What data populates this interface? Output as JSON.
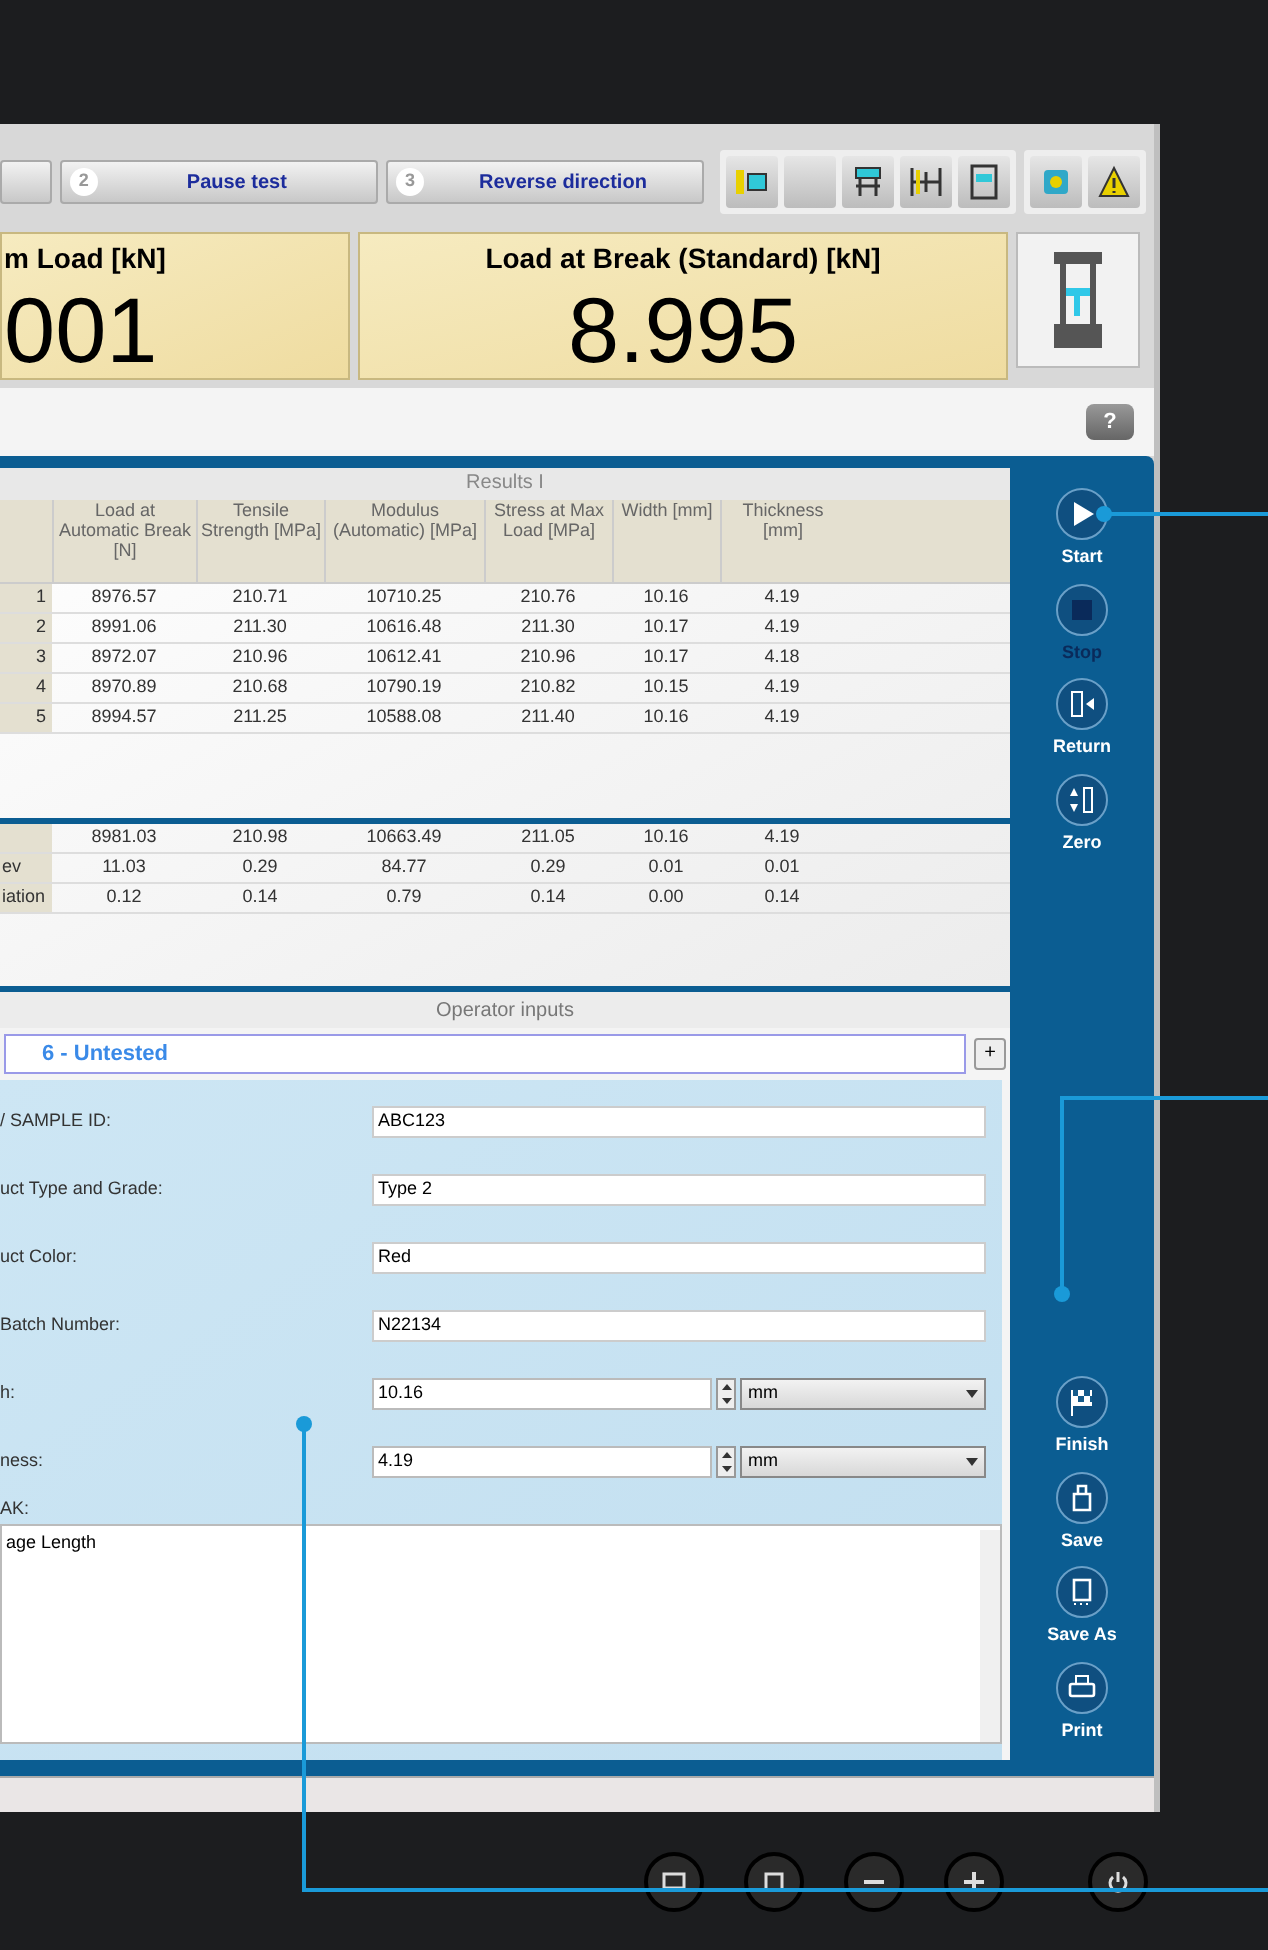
{
  "toolbar": {
    "steps": [
      {
        "selected": false
      },
      {
        "number": "2",
        "label": "Pause test",
        "selected": false
      },
      {
        "number": "3",
        "label": "Reverse direction",
        "selected": false
      }
    ]
  },
  "help_button": "?",
  "readouts": [
    {
      "label": "m Load [kN]",
      "value": "001"
    },
    {
      "label": "Load at Break (Standard) [kN]",
      "value": "8.995"
    }
  ],
  "results": {
    "title": "Results I",
    "columns": [
      "Load at Automatic Break [N]",
      "Tensile Strength [MPa]",
      "Modulus (Automatic) [MPa]",
      "Stress at Max Load [MPa]",
      "Width [mm]",
      "Thickness [mm]"
    ],
    "rows": [
      {
        "label": "1",
        "cells": [
          "8976.57",
          "210.71",
          "10710.25",
          "210.76",
          "10.16",
          "4.19"
        ]
      },
      {
        "label": "2",
        "cells": [
          "8991.06",
          "211.30",
          "10616.48",
          "211.30",
          "10.17",
          "4.19"
        ]
      },
      {
        "label": "3",
        "cells": [
          "8972.07",
          "210.96",
          "10612.41",
          "210.96",
          "10.17",
          "4.18"
        ]
      },
      {
        "label": "4",
        "cells": [
          "8970.89",
          "210.68",
          "10790.19",
          "210.82",
          "10.15",
          "4.19"
        ]
      },
      {
        "label": "5",
        "cells": [
          "8994.57",
          "211.25",
          "10588.08",
          "211.40",
          "10.16",
          "4.19"
        ]
      }
    ],
    "stats": [
      {
        "cells": [
          "8981.03",
          "210.98",
          "10663.49",
          "211.05",
          "10.16",
          "4.19"
        ]
      },
      {
        "label": "ev",
        "cells": [
          "11.03",
          "0.29",
          "84.77",
          "0.29",
          "0.01",
          "0.01"
        ]
      },
      {
        "label": "iation",
        "cells": [
          "0.12",
          "0.14",
          "0.79",
          "0.14",
          "0.00",
          "0.14"
        ]
      }
    ]
  },
  "operator_inputs": {
    "title": "Operator inputs",
    "specimen": "6 - Untested",
    "add_button": "+",
    "fields": [
      {
        "kind": "text",
        "label": "/ SAMPLE ID:",
        "value": "ABC123"
      },
      {
        "kind": "text",
        "label": "uct Type and Grade:",
        "value": "Type 2"
      },
      {
        "kind": "text",
        "label": "uct Color:",
        "value": "Red"
      },
      {
        "kind": "text",
        "label": "Batch Number:",
        "value": "N22134"
      },
      {
        "kind": "number",
        "label": "h:",
        "value": "10.16",
        "unit": "mm"
      },
      {
        "kind": "number",
        "label": "ness:",
        "value": "4.19",
        "unit": "mm"
      }
    ],
    "notes": {
      "label": "AK:",
      "value": "age Length"
    }
  },
  "sidebar": {
    "top": [
      {
        "label": "Start",
        "disabled": false
      },
      {
        "label": "Stop",
        "disabled": true
      },
      {
        "label": "Return",
        "disabled": false
      },
      {
        "label": "Zero",
        "disabled": false
      }
    ],
    "bottom": [
      {
        "label": "Finish",
        "disabled": false
      },
      {
        "label": "Save",
        "disabled": false
      },
      {
        "label": "Save As",
        "disabled": false
      },
      {
        "label": "Print",
        "disabled": false
      }
    ]
  }
}
